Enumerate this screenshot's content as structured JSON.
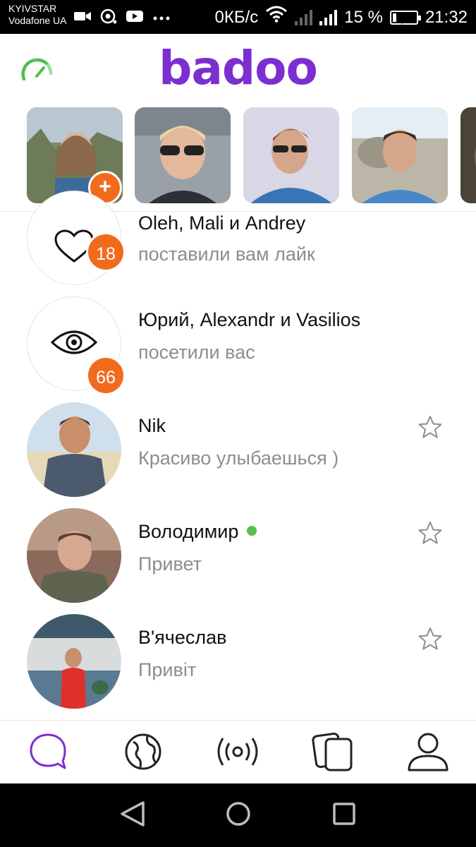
{
  "status_bar": {
    "carrier_1": "KYIVSTAR",
    "carrier_2": "Vodafone UA",
    "network_speed": "0КБ/с",
    "battery_level": "15 %",
    "battery_fraction": 0.15,
    "time": "21:32",
    "icons": [
      "video-icon",
      "camera-icon",
      "youtube-icon",
      "more-icon",
      "wifi-icon",
      "signal-icon",
      "battery-icon"
    ]
  },
  "header": {
    "logo": "badoo",
    "left_icon": "speedometer-icon",
    "brand_color": "#7b2fd0"
  },
  "stories": {
    "add_label": "+",
    "accent_color": "#f26b1d",
    "items": [
      {
        "name": "story-1",
        "has_add": true
      },
      {
        "name": "story-2"
      },
      {
        "name": "story-3"
      },
      {
        "name": "story-4"
      },
      {
        "name": "story-5"
      }
    ]
  },
  "list": [
    {
      "type": "likes",
      "icon": "heart-icon",
      "count": "18",
      "name": "Oleh, Mali и Andrey",
      "sub": "поставили вам лайк"
    },
    {
      "type": "visits",
      "icon": "eye-icon",
      "count": "66",
      "name": "Юрий, Alexandr и Vasilios",
      "sub": "посетили вас"
    },
    {
      "type": "chat",
      "name": "Nik",
      "sub": "Красиво улыбаешься )",
      "online": false
    },
    {
      "type": "chat",
      "name": "Володимир",
      "sub": "Привет",
      "online": true
    },
    {
      "type": "chat",
      "name": "В'ячеслав",
      "sub": "Привіт",
      "online": false
    }
  ],
  "bottom_nav": {
    "items": [
      {
        "icon": "chat-bubble-icon",
        "active": true
      },
      {
        "icon": "globe-icon",
        "active": false
      },
      {
        "icon": "broadcast-icon",
        "active": false
      },
      {
        "icon": "cards-icon",
        "active": false
      },
      {
        "icon": "profile-icon",
        "active": false
      }
    ],
    "active_color": "#7b2fd0"
  },
  "system_nav": {
    "buttons": [
      "back-icon",
      "home-icon",
      "recents-icon"
    ]
  },
  "colors": {
    "online": "#54c151",
    "muted_text": "#8d8d8d"
  }
}
